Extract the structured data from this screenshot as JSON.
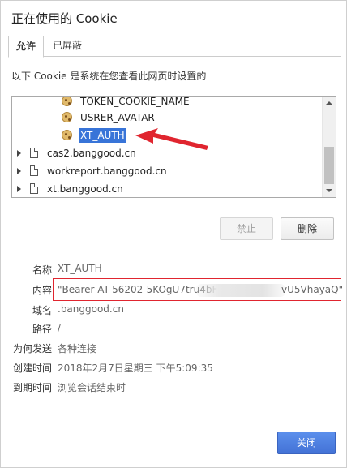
{
  "dialog": {
    "title": "正在使用的 Cookie"
  },
  "tabs": [
    {
      "label": "允许",
      "active": true
    },
    {
      "label": "已屏蔽",
      "active": false
    }
  ],
  "description": "以下 Cookie 是系统在您查看此网页时设置的",
  "tree": {
    "items": [
      {
        "label": "TOKEN_COOKIE_NAME",
        "type": "cookie",
        "selected": false
      },
      {
        "label": "USRER_AVATAR",
        "type": "cookie",
        "selected": false
      },
      {
        "label": "XT_AUTH",
        "type": "cookie",
        "selected": true
      },
      {
        "label": "cas2.banggood.cn",
        "type": "site",
        "selected": false
      },
      {
        "label": "workreport.banggood.cn",
        "type": "site",
        "selected": false
      },
      {
        "label": "xt.banggood.cn",
        "type": "site",
        "selected": false
      }
    ]
  },
  "buttons": {
    "block": "禁止",
    "delete": "删除",
    "close": "关闭"
  },
  "details": {
    "name_label": "名称",
    "name_value": "XT_AUTH",
    "content_label": "内容",
    "content_value_start": "\"Bearer AT-56202-5KOgU7tru4bF",
    "content_value_end": "vU5VhayaQ\"",
    "domain_label": "域名",
    "domain_value": ".banggood.cn",
    "path_label": "路径",
    "path_value": "/",
    "send_for_label": "为何发送",
    "send_for_value": "各种连接",
    "created_label": "创建时间",
    "created_value": "2018年2月7日星期三 下午5:09:35",
    "expires_label": "到期时间",
    "expires_value": "浏览会话结束时"
  },
  "colors": {
    "selection": "#3874d8",
    "annotation_red": "#e0252f",
    "primary_button": "#4372d6"
  }
}
